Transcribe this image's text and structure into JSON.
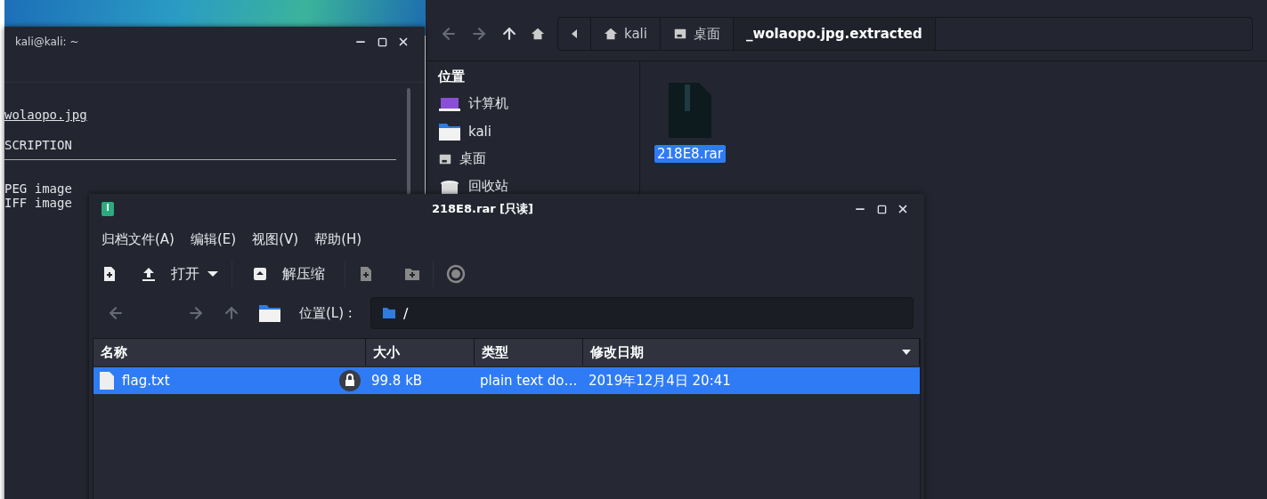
{
  "terminal": {
    "title": "kali@kali: ~",
    "lines": [
      {
        "kind": "link",
        "text": "wolaopo.jpg"
      },
      {
        "kind": "heading",
        "text": "SCRIPTION"
      },
      {
        "kind": "text",
        "text": "PEG image"
      },
      {
        "kind": "text",
        "text": "IFF image"
      }
    ]
  },
  "file_manager": {
    "path": [
      {
        "kind": "home",
        "label": "kali",
        "selected": false
      },
      {
        "kind": "desktop",
        "label": "桌面",
        "selected": false
      },
      {
        "kind": "plain",
        "label": "_wolaopo.jpg.extracted",
        "selected": true
      }
    ],
    "sidebar": {
      "heading": "位置",
      "items": [
        {
          "kind": "computer",
          "label": "计算机"
        },
        {
          "kind": "folder",
          "label": "kali"
        },
        {
          "kind": "desktop",
          "label": "桌面"
        },
        {
          "kind": "trash",
          "label": "回收站"
        }
      ]
    },
    "files": [
      {
        "name": "218E8.rar",
        "selected": true
      }
    ]
  },
  "archive": {
    "title": "218E8.rar [只读]",
    "menu": [
      "归档文件(A)",
      "编辑(E)",
      "视图(V)",
      "帮助(H)"
    ],
    "open_label": "打开",
    "extract_label": "解压缩",
    "location_label": "位置(L) :",
    "location": "/",
    "columns": [
      "名称",
      "大小",
      "类型",
      "修改日期"
    ],
    "rows": [
      {
        "name": "flag.txt",
        "locked": true,
        "size": "99.8 kB",
        "type": "plain text do…",
        "modified": "2019年12月4日 20:41",
        "selected": true
      }
    ]
  }
}
